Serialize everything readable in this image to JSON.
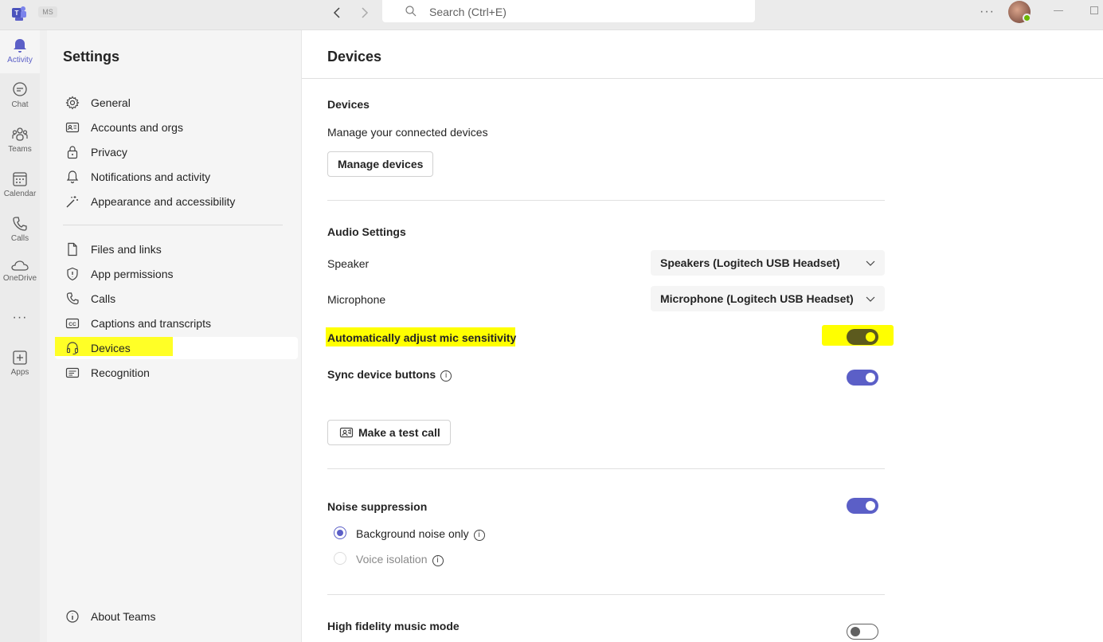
{
  "titlebar": {
    "org_badge": "MS",
    "search_placeholder": "Search (Ctrl+E)",
    "more": "···"
  },
  "rail": {
    "items": [
      {
        "label": "Activity",
        "icon": "bell-icon"
      },
      {
        "label": "Chat",
        "icon": "chat-icon"
      },
      {
        "label": "Teams",
        "icon": "teams-icon"
      },
      {
        "label": "Calendar",
        "icon": "calendar-icon"
      },
      {
        "label": "Calls",
        "icon": "phone-icon"
      },
      {
        "label": "OneDrive",
        "icon": "cloud-icon"
      },
      {
        "label": "Apps",
        "icon": "add-app-icon"
      }
    ],
    "more": "···"
  },
  "settings": {
    "title": "Settings",
    "items": [
      {
        "label": "General",
        "icon": "gear-icon"
      },
      {
        "label": "Accounts and orgs",
        "icon": "id-card-icon"
      },
      {
        "label": "Privacy",
        "icon": "lock-icon"
      },
      {
        "label": "Notifications and activity",
        "icon": "bell-icon"
      },
      {
        "label": "Appearance and accessibility",
        "icon": "wand-icon"
      },
      {
        "label": "Files and links",
        "icon": "file-icon"
      },
      {
        "label": "App permissions",
        "icon": "shield-icon"
      },
      {
        "label": "Calls",
        "icon": "phone-icon"
      },
      {
        "label": "Captions and transcripts",
        "icon": "cc-icon"
      },
      {
        "label": "Devices",
        "icon": "headset-icon"
      },
      {
        "label": "Recognition",
        "icon": "recognition-icon"
      }
    ],
    "about": "About Teams",
    "selected": "Devices"
  },
  "main": {
    "title": "Devices",
    "devices_section": {
      "title": "Devices",
      "description": "Manage your connected devices",
      "button": "Manage devices"
    },
    "audio": {
      "title": "Audio Settings",
      "speaker_label": "Speaker",
      "speaker_value": "Speakers (Logitech USB Headset)",
      "microphone_label": "Microphone",
      "microphone_value": "Microphone (Logitech USB Headset)",
      "auto_adjust_label": "Automatically adjust mic sensitivity",
      "auto_adjust_on": true,
      "sync_label": "Sync device buttons",
      "sync_on": true,
      "test_call_button": "Make a test call"
    },
    "noise": {
      "title": "Noise suppression",
      "on": true,
      "options": [
        {
          "label": "Background noise only",
          "checked": true
        },
        {
          "label": "Voice isolation",
          "checked": false
        }
      ]
    },
    "hifi": {
      "title": "High fidelity music mode",
      "on": false
    }
  },
  "colors": {
    "accent": "#5b5fc7",
    "highlight": "#ffff00"
  }
}
